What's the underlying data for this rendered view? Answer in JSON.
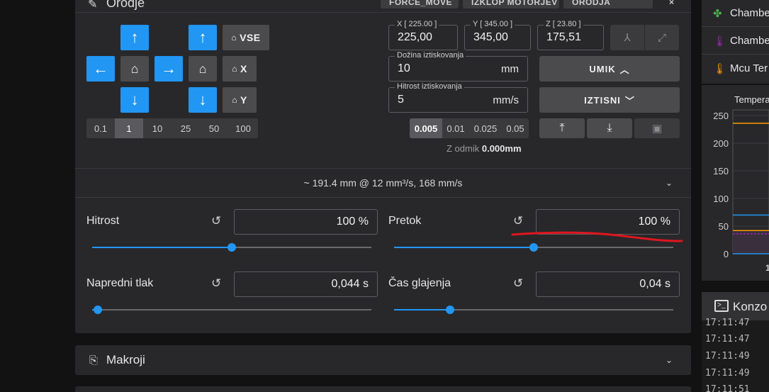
{
  "tool": {
    "title": "Orodje",
    "header_buttons": [
      "FORCE_MOVE",
      "IZKLOP MOTORJEV",
      "ORODJA"
    ],
    "home_all": "VSE",
    "home_x": "X",
    "home_y": "Y",
    "steps": [
      "0.1",
      "1",
      "10",
      "25",
      "50",
      "100"
    ],
    "active_step": "1",
    "pos_x_label": "X [ 225.00 ]",
    "pos_x_value": "225,00",
    "pos_y_label": "Y [ 345.00 ]",
    "pos_y_value": "345,00",
    "pos_z_label": "Z [ 23.80 ]",
    "pos_z_value": "175,51",
    "extrude_length_label": "Dožina iztiskovanja",
    "extrude_length_value": "10",
    "extrude_length_unit": "mm",
    "extrude_speed_label": "Hitrost iztiskovanja",
    "extrude_speed_value": "5",
    "extrude_speed_unit": "mm/s",
    "retract_label": "UMIK",
    "extrude_label": "IZTISNI",
    "z_steps": [
      "0.005",
      "0.01",
      "0.025",
      "0.05"
    ],
    "active_z_step": "0.005",
    "z_offset_label": "Z odmik",
    "z_offset_value": "0.000mm"
  },
  "estimate": "~ 191.4 mm @ 12 mm³/s, 168 mm/s",
  "sliders": {
    "speed_label": "Hitrost",
    "speed_value": "100 %",
    "speed_fraction": 0.5,
    "flow_label": "Pretok",
    "flow_value": "100 %",
    "flow_fraction": 0.5,
    "pa_label": "Napredni tlak",
    "pa_value": "0,044 s",
    "pa_fraction": 0.02,
    "smooth_label": "Čas glajenja",
    "smooth_value": "0,04 s",
    "smooth_fraction": 0.2
  },
  "macros_title": "Makroji",
  "sensors": [
    {
      "name": "Chambe",
      "color": "#4caf50",
      "icon": "fan-icon"
    },
    {
      "name": "Chambe",
      "color": "#9c27b0",
      "icon": "thermometer-icon"
    },
    {
      "name": "Mcu Ter",
      "color": "#ff9800",
      "icon": "thermometer-icon"
    }
  ],
  "chart_data": {
    "type": "line",
    "title": "Tempera",
    "y_ticks": [
      "250",
      "200",
      "150",
      "100",
      "50",
      "0"
    ],
    "ylim": [
      0,
      250
    ],
    "series": [
      {
        "color": "#ff9800",
        "values": [
          236,
          236
        ]
      },
      {
        "color": "#2196f3",
        "values": [
          70,
          70
        ]
      },
      {
        "color": "#ff9800",
        "values": [
          42,
          42
        ]
      },
      {
        "color": "#9c27b0",
        "values": [
          36,
          36
        ]
      },
      {
        "color": "#2196f3",
        "values": [
          0,
          0
        ]
      }
    ],
    "x_tick_visible": "1"
  },
  "console": {
    "title": "Konzo",
    "lines": [
      "17:11:47",
      "17:11:47",
      "17:11:49",
      "17:11:49",
      "17:11:51"
    ]
  },
  "colors": {
    "accent": "#2196f3",
    "panel": "#28282b",
    "annotation": "#e0161e"
  }
}
